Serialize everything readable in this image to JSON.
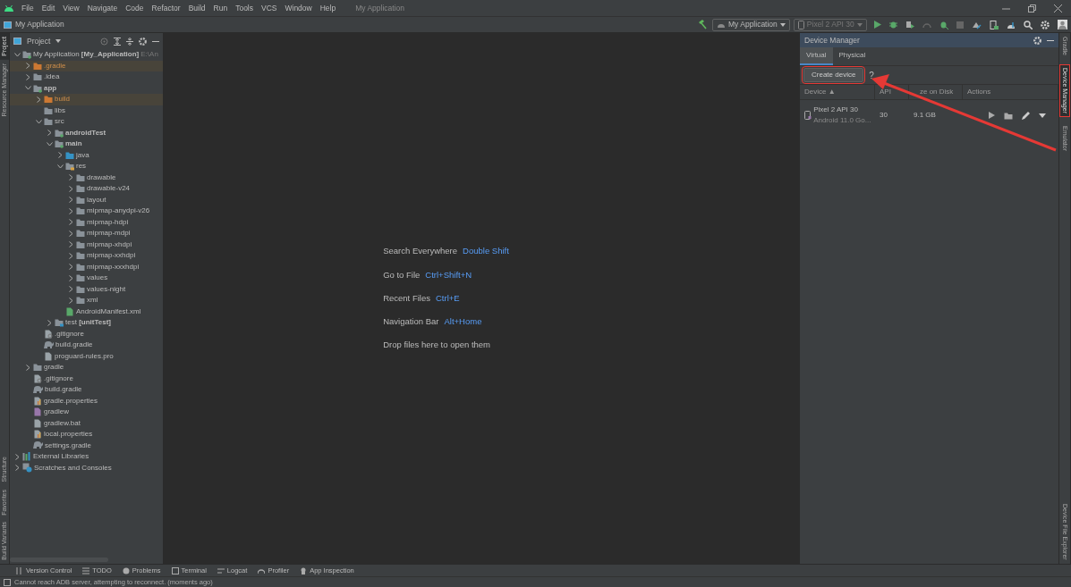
{
  "menu_bar": {
    "items": [
      "File",
      "Edit",
      "View",
      "Navigate",
      "Code",
      "Refactor",
      "Build",
      "Run",
      "Tools",
      "VCS",
      "Window",
      "Help"
    ],
    "window_title": "My Application"
  },
  "toolbar": {
    "breadcrumb": "My Application",
    "run_config": "My Application",
    "device": "Pixel 2 API 30",
    "device_disabled": true
  },
  "left_strip": [
    {
      "label": "Project",
      "selected": true
    },
    {
      "label": "Resource Manager",
      "selected": false
    },
    {
      "label": "Structure",
      "selected": false
    },
    {
      "label": "Favorites",
      "selected": false
    },
    {
      "label": "Build Variants",
      "selected": false
    }
  ],
  "project": {
    "title": "Project",
    "tree": [
      {
        "label": "My Application **[My_Application]**",
        "path": "E:\\An",
        "kind": "module",
        "expanded": true,
        "children": [
          {
            "label": ".gradle",
            "kind": "excluded",
            "expanded": false,
            "highlighted": true
          },
          {
            "label": ".idea",
            "kind": "folder",
            "expanded": false
          },
          {
            "label": "app",
            "kind": "module",
            "bold": true,
            "expanded": true,
            "children": [
              {
                "label": "build",
                "kind": "excluded",
                "expanded": false,
                "highlighted": true
              },
              {
                "label": "libs",
                "kind": "folder"
              },
              {
                "label": "src",
                "kind": "folder",
                "expanded": true,
                "children": [
                  {
                    "label": "androidTest",
                    "kind": "source",
                    "bold": true,
                    "expanded": false
                  },
                  {
                    "label": "main",
                    "kind": "source",
                    "bold": true,
                    "expanded": true,
                    "children": [
                      {
                        "label": "java",
                        "kind": "java",
                        "expanded": false
                      },
                      {
                        "label": "res",
                        "kind": "res",
                        "expanded": true,
                        "children": [
                          {
                            "label": "drawable",
                            "kind": "folder",
                            "expanded": false
                          },
                          {
                            "label": "drawable-v24",
                            "kind": "folder",
                            "expanded": false
                          },
                          {
                            "label": "layout",
                            "kind": "folder",
                            "expanded": false
                          },
                          {
                            "label": "mipmap-anydpi-v26",
                            "kind": "folder",
                            "expanded": false
                          },
                          {
                            "label": "mipmap-hdpi",
                            "kind": "folder",
                            "expanded": false
                          },
                          {
                            "label": "mipmap-mdpi",
                            "kind": "folder",
                            "expanded": false
                          },
                          {
                            "label": "mipmap-xhdpi",
                            "kind": "folder",
                            "expanded": false
                          },
                          {
                            "label": "mipmap-xxhdpi",
                            "kind": "folder",
                            "expanded": false
                          },
                          {
                            "label": "mipmap-xxxhdpi",
                            "kind": "folder",
                            "expanded": false
                          },
                          {
                            "label": "values",
                            "kind": "folder",
                            "expanded": false
                          },
                          {
                            "label": "values-night",
                            "kind": "folder",
                            "expanded": false
                          },
                          {
                            "label": "xml",
                            "kind": "folder",
                            "expanded": false
                          }
                        ]
                      },
                      {
                        "label": "AndroidManifest.xml",
                        "kind": "manifest"
                      }
                    ]
                  },
                  {
                    "label": "test **[unitTest]**",
                    "kind": "test",
                    "expanded": false
                  }
                ]
              },
              {
                "label": ".gitignore",
                "kind": "ignore"
              },
              {
                "label": "build.gradle",
                "kind": "gradle"
              },
              {
                "label": "proguard-rules.pro",
                "kind": "file"
              }
            ]
          },
          {
            "label": "gradle",
            "kind": "folder",
            "expanded": false
          },
          {
            "label": ".gitignore",
            "kind": "ignore"
          },
          {
            "label": "build.gradle",
            "kind": "gradle"
          },
          {
            "label": "gradle.properties",
            "kind": "properties"
          },
          {
            "label": "gradlew",
            "kind": "script"
          },
          {
            "label": "gradlew.bat",
            "kind": "file"
          },
          {
            "label": "local.properties",
            "kind": "properties"
          },
          {
            "label": "settings.gradle",
            "kind": "gradle"
          }
        ]
      },
      {
        "label": "External Libraries",
        "kind": "library",
        "expanded": false
      },
      {
        "label": "Scratches and Consoles",
        "kind": "scratch",
        "expanded": false
      }
    ]
  },
  "editor_hints": [
    {
      "action": "Search Everywhere",
      "shortcut": "Double Shift"
    },
    {
      "action": "Go to File",
      "shortcut": "Ctrl+Shift+N"
    },
    {
      "action": "Recent Files",
      "shortcut": "Ctrl+E"
    },
    {
      "action": "Navigation Bar",
      "shortcut": "Alt+Home"
    },
    {
      "action": "Drop files here to open them"
    }
  ],
  "device_manager": {
    "title": "Device Manager",
    "tabs": [
      {
        "label": "Virtual",
        "selected": true
      },
      {
        "label": "Physical",
        "selected": false
      }
    ],
    "create_button": {
      "label": "Create device",
      "highlighted": true
    },
    "help": "?",
    "columns": [
      "Device ▲",
      "API",
      "ze on Disk",
      "Actions"
    ],
    "rows": [
      {
        "name": "Pixel 2 API 30",
        "subtitle": "Android 11.0 Go...",
        "api": "30",
        "size": "9.1 GB"
      }
    ]
  },
  "right_strip": [
    {
      "label": "Gradle",
      "selected": false,
      "highlighted": false
    },
    {
      "label": "Device Manager",
      "selected": true,
      "highlighted": true
    },
    {
      "label": "Emulator",
      "selected": false,
      "highlighted": false
    },
    {
      "label": "Device File Explorer",
      "selected": false,
      "highlighted": false
    }
  ],
  "callout_arrow": true,
  "bottom_tabs": [
    "Version Control",
    "TODO",
    "Problems",
    "Terminal",
    "Logcat",
    "Profiler",
    "App Inspection"
  ],
  "status_bar": "Cannot reach ADB server, attempting to reconnect. (moments ago)"
}
